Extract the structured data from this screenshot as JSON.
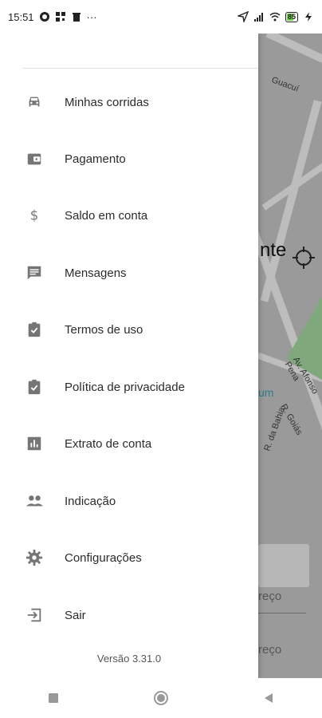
{
  "status": {
    "time": "15:51",
    "battery": "85"
  },
  "map": {
    "headline": "nte",
    "street1": "Guacuí",
    "street2": "Av. Afonso Pena",
    "street3": "R. Goiás",
    "street4": "R. da Bahia",
    "park_text": "um",
    "field1": "reço",
    "field2": "reço"
  },
  "menu": {
    "items": [
      {
        "label": "Minhas corridas",
        "icon": "car-icon"
      },
      {
        "label": "Pagamento",
        "icon": "wallet-icon"
      },
      {
        "label": "Saldo em conta",
        "icon": "dollar-icon"
      },
      {
        "label": "Mensagens",
        "icon": "message-icon"
      },
      {
        "label": "Termos de uso",
        "icon": "clipboard-check-icon"
      },
      {
        "label": "Política de privacidade",
        "icon": "clipboard-check-icon"
      },
      {
        "label": "Extrato de conta",
        "icon": "bar-chart-icon"
      },
      {
        "label": "Indicação",
        "icon": "people-icon"
      },
      {
        "label": "Configurações",
        "icon": "gear-icon"
      },
      {
        "label": "Sair",
        "icon": "exit-icon"
      }
    ],
    "version": "Versão 3.31.0"
  },
  "colors": {
    "icon": "#757575",
    "text": "#2b2b2b",
    "scrim": "#9a9a9a"
  }
}
